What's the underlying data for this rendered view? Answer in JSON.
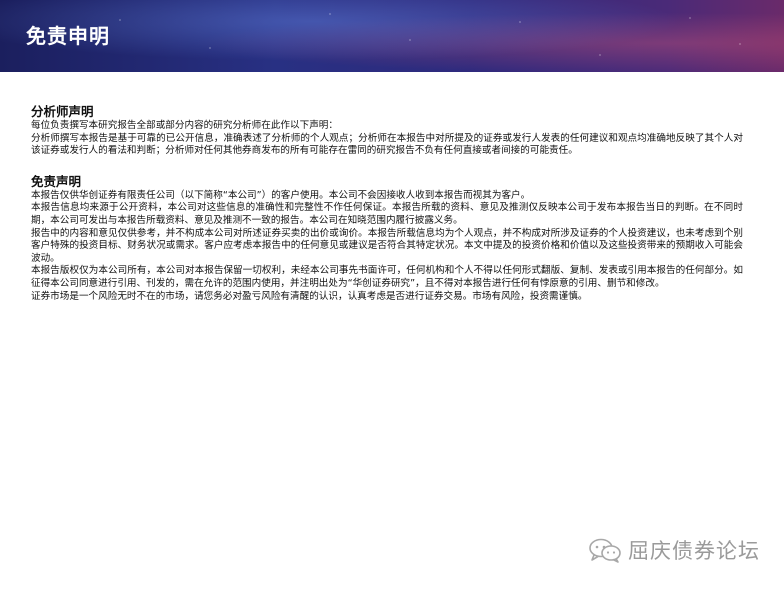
{
  "header": {
    "title": "免责申明"
  },
  "sections": [
    {
      "heading": "分析师声明",
      "paragraphs": [
        "每位负责撰写本研究报告全部或部分内容的研究分析师在此作以下声明：",
        "分析师撰写本报告是基于可靠的已公开信息，准确表述了分析师的个人观点；分析师在本报告中对所提及的证券或发行人发表的任何建议和观点均准确地反映了其个人对该证券或发行人的看法和判断；分析师对任何其他券商发布的所有可能存在雷同的研究报告不负有任何直接或者间接的可能责任。"
      ]
    },
    {
      "heading": "免责声明",
      "paragraphs": [
        "本报告仅供华创证券有限责任公司（以下简称“本公司”）的客户使用。本公司不会因接收人收到本报告而视其为客户。",
        "本报告信息均来源于公开资料，本公司对这些信息的准确性和完整性不作任何保证。本报告所载的资料、意见及推测仅反映本公司于发布本报告当日的判断。在不同时期，本公司可发出与本报告所载资料、意见及推测不一致的报告。本公司在知晓范围内履行披露义务。",
        "报告中的内容和意见仅供参考，并不构成本公司对所述证券买卖的出价或询价。本报告所载信息均为个人观点，并不构成对所涉及证券的个人投资建议，也未考虑到个别客户特殊的投资目标、财务状况或需求。客户应考虑本报告中的任何意见或建议是否符合其特定状况。本文中提及的投资价格和价值以及这些投资带来的预期收入可能会波动。",
        "本报告版权仅为本公司所有，本公司对本报告保留一切权利，未经本公司事先书面许可，任何机构和个人不得以任何形式翻版、复制、发表或引用本报告的任何部分。如征得本公司同意进行引用、刊发的，需在允许的范围内使用，并注明出处为“华创证券研究”，且不得对本报告进行任何有悖原意的引用、删节和修改。",
        "证券市场是一个风险无时不在的市场，请您务必对盈亏风险有清醒的认识，认真考虑是否进行证券交易。市场有风险，投资需谨慎。"
      ]
    }
  ],
  "watermark": {
    "text": "屈庆债券论坛",
    "icon": "wechat-icon"
  }
}
